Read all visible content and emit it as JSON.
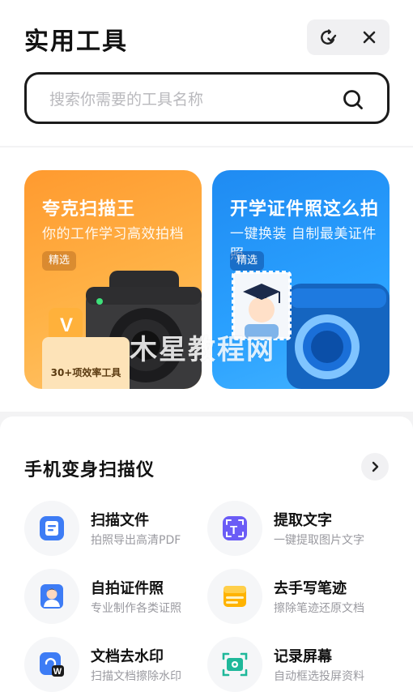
{
  "header": {
    "title": "实用工具",
    "actions": [
      {
        "icon": "refresh-check-icon"
      },
      {
        "icon": "close-icon"
      }
    ]
  },
  "search": {
    "placeholder": "搜索你需要的工具名称",
    "value": "",
    "icon": "search-icon"
  },
  "banners": [
    {
      "title": "夸克扫描王",
      "subtitle": "你的工作学习高效拍档",
      "badge": "精选",
      "promo": "30+项效率工具",
      "color": "#ff9f35"
    },
    {
      "title": "开学证件照这么拍",
      "subtitle": "一键换装 自制最美证件照",
      "badge": "精选",
      "color": "#2196f3"
    }
  ],
  "watermark": "木星教程网",
  "scanner": {
    "title": "手机变身扫描仪",
    "tools": [
      {
        "name": "扫描文件",
        "desc": "拍照导出高清PDF",
        "icon": "scan-file-icon"
      },
      {
        "name": "提取文字",
        "desc": "一键提取图片文字",
        "icon": "extract-text-icon"
      },
      {
        "name": "自拍证件照",
        "desc": "专业制作各类证照",
        "icon": "id-photo-icon"
      },
      {
        "name": "去手写笔迹",
        "desc": "擦除笔迹还原文档",
        "icon": "remove-handwriting-icon"
      },
      {
        "name": "文档去水印",
        "desc": "扫描文档擦除水印",
        "icon": "remove-watermark-icon"
      },
      {
        "name": "记录屏幕",
        "desc": "自动框选投屏资料",
        "icon": "record-screen-icon"
      }
    ]
  },
  "colors": {
    "accent_blue": "#3d7cf5",
    "accent_purple": "#6b5cf6",
    "accent_orange": "#ff9f35",
    "accent_teal": "#1fb89a"
  }
}
